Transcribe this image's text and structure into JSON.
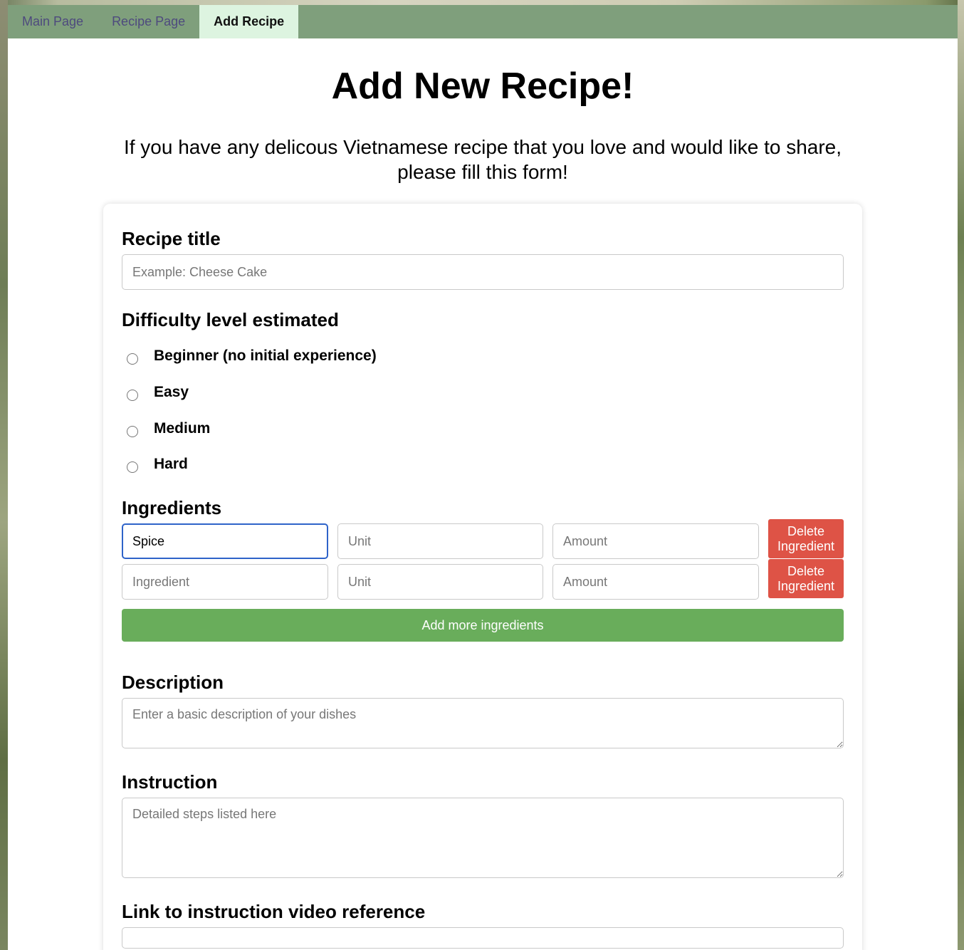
{
  "nav": {
    "tabs": [
      {
        "label": "Main Page"
      },
      {
        "label": "Recipe Page"
      },
      {
        "label": "Add Recipe"
      }
    ],
    "active_tab": "Add Recipe"
  },
  "header": {
    "title": "Add New Recipe!",
    "intro_line1": "If you have any delicous Vietnamese recipe that you love and would like to share,",
    "intro_line2": "please fill this form!"
  },
  "form": {
    "title_label": "Recipe title",
    "title_placeholder": "Example: Cheese Cake",
    "difficulty_label": "Difficulty level estimated",
    "difficulty_options": [
      {
        "label": "Beginner (no initial experience)"
      },
      {
        "label": "Easy"
      },
      {
        "label": "Medium"
      },
      {
        "label": "Hard"
      }
    ],
    "ingredients_label": "Ingredients",
    "ingredient_rows": [
      {
        "ingredient_value": "Spice",
        "ingredient_placeholder": "Ingredient",
        "unit_placeholder": "Unit",
        "amount_placeholder": "Amount",
        "delete_label": "Delete Ingredient"
      },
      {
        "ingredient_value": "",
        "ingredient_placeholder": "Ingredient",
        "unit_placeholder": "Unit",
        "amount_placeholder": "Amount",
        "delete_label": "Delete Ingredient"
      }
    ],
    "add_ingredients_label": "Add more ingredients",
    "description_label": "Description",
    "description_placeholder": "Enter a basic description of your dishes",
    "instruction_label": "Instruction",
    "instruction_placeholder": "Detailed steps listed here",
    "video_label": "Link to instruction video reference"
  },
  "colors": {
    "navbar": "#7f9f7c",
    "active_tab": "#ddf4e0",
    "delete_button": "#de5346",
    "add_button": "#69ad5b",
    "focus_border": "#2e63c9"
  }
}
